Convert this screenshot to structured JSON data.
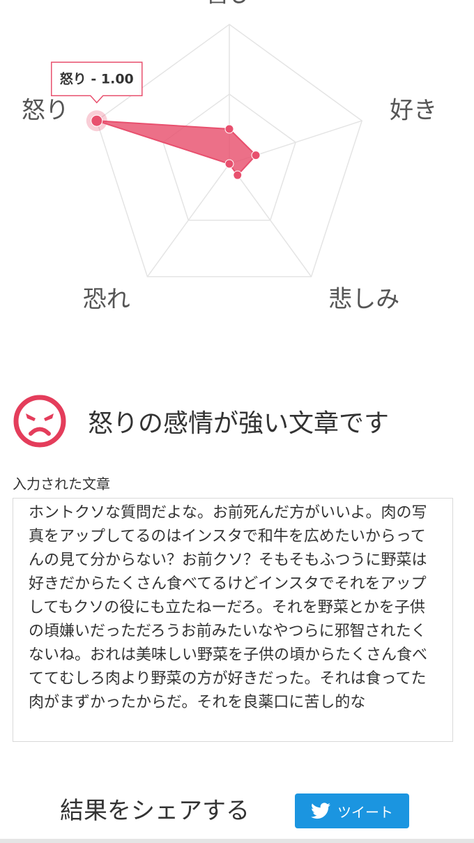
{
  "chart_data": {
    "type": "radar",
    "axes": [
      "喜び",
      "好き",
      "悲しみ",
      "恐れ",
      "怒り"
    ],
    "values": [
      0.25,
      0.2,
      0.1,
      0.0,
      1.0
    ],
    "range": [
      0,
      1
    ],
    "rings": 2,
    "series_color": "#e8506e",
    "grid": true,
    "tooltip": "怒り - 1.00"
  },
  "result": {
    "icon": "angry-face-icon",
    "text": "怒りの感情が強い文章です",
    "accent": "#e43d5b"
  },
  "input": {
    "label": "入力された文章",
    "text": "ホントクソな質問だよな。お前死んだ方がいいよ。肉の写真をアップしてるのはインスタで和牛を広めたいからってんの見て分からない？お前クソ？そもそもふつうに野菜は好きだからたくさん食べてるけどインスタでそれをアップしてもクソの役にも立たねーだろ。それを野菜とかを子供の頃嫌いだっただろうお前みたいなやつらに邪智されたくないね。おれは美味しい野菜を子供の頃からたくさん食べててむしろ肉より野菜の方が好きだった。それは食ってた肉がまずかったからだ。それを良薬口に苦し的な"
  },
  "share": {
    "label": "結果をシェアする",
    "tweet_label": "ツイート",
    "button_color": "#1b95e0"
  }
}
